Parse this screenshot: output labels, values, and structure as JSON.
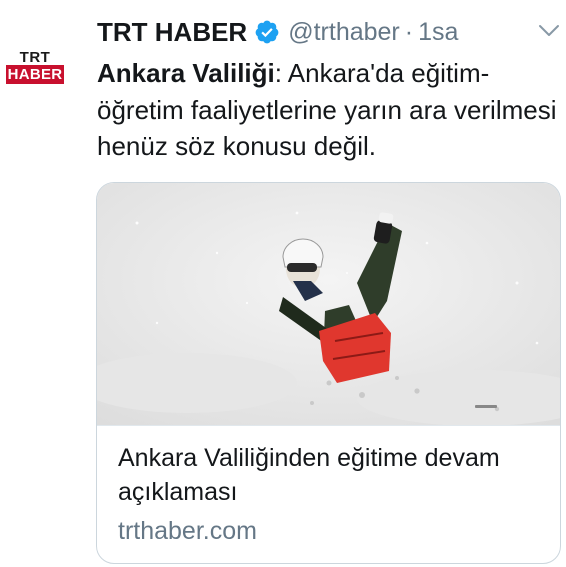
{
  "account": {
    "name": "TRT HABER",
    "handle": "@trthaber",
    "separator": "·",
    "time": "1sa",
    "avatar_line1": "TRT",
    "avatar_line2": "HABER",
    "verified": true
  },
  "tweet": {
    "bold_prefix": "Ankara Valiliği",
    "text": ": Ankara'da eğitim-öğretim faaliyetlerine yarın ara verilmesi henüz söz konusu değil."
  },
  "card": {
    "image_icon": "sledding-child-photo",
    "title": "Ankara Valiliğinden eğitime devam açıklaması",
    "domain": "trthaber.com"
  },
  "icons": {
    "verified": "verified-badge-icon",
    "menu": "chevron-down-icon"
  },
  "colors": {
    "verified_blue": "#1da1f2",
    "secondary_text": "#657786",
    "brand_red": "#c8102e",
    "border": "#ccd6dd"
  }
}
